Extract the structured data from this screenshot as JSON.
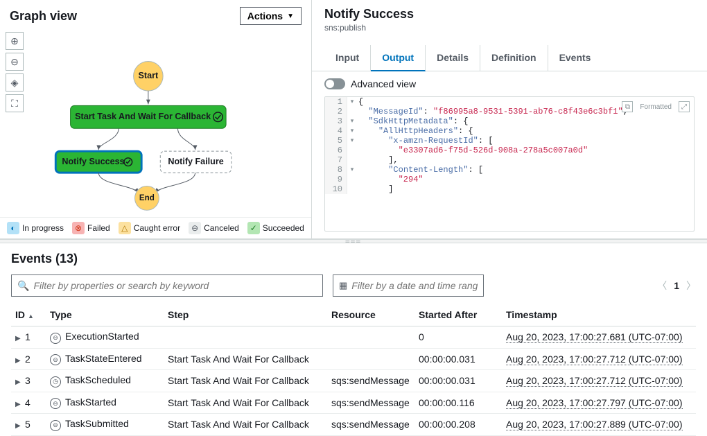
{
  "graph": {
    "title": "Graph view",
    "actions_label": "Actions",
    "nodes": {
      "start": "Start",
      "task": "Start Task And Wait For Callback",
      "success": "Notify Success",
      "failure": "Notify Failure",
      "end": "End"
    },
    "legend": {
      "in_progress": "In progress",
      "failed": "Failed",
      "caught": "Caught error",
      "canceled": "Canceled",
      "succeeded": "Succeeded"
    }
  },
  "detail": {
    "title": "Notify Success",
    "subtitle": "sns:publish",
    "tabs": {
      "input": "Input",
      "output": "Output",
      "details": "Details",
      "definition": "Definition",
      "events": "Events"
    },
    "advanced_label": "Advanced view",
    "formatted_label": "Formatted",
    "code": [
      {
        "n": 1,
        "fold": "▾",
        "indent": 0,
        "tokens": [
          {
            "t": "{",
            "c": "punc"
          }
        ]
      },
      {
        "n": 2,
        "fold": "",
        "indent": 1,
        "tokens": [
          {
            "t": "\"MessageId\"",
            "c": "key"
          },
          {
            "t": ": ",
            "c": "punc"
          },
          {
            "t": "\"f86995a8-9531-5391-ab76-c8f43e6c3bf1\"",
            "c": "str"
          },
          {
            "t": ",",
            "c": "punc"
          }
        ]
      },
      {
        "n": 3,
        "fold": "▾",
        "indent": 1,
        "tokens": [
          {
            "t": "\"SdkHttpMetadata\"",
            "c": "key"
          },
          {
            "t": ": {",
            "c": "punc"
          }
        ]
      },
      {
        "n": 4,
        "fold": "▾",
        "indent": 2,
        "tokens": [
          {
            "t": "\"AllHttpHeaders\"",
            "c": "key"
          },
          {
            "t": ": {",
            "c": "punc"
          }
        ]
      },
      {
        "n": 5,
        "fold": "▾",
        "indent": 3,
        "tokens": [
          {
            "t": "\"x-amzn-RequestId\"",
            "c": "key"
          },
          {
            "t": ": [",
            "c": "punc"
          }
        ]
      },
      {
        "n": 6,
        "fold": "",
        "indent": 4,
        "tokens": [
          {
            "t": "\"e3307ad6-f75d-526d-908a-278a5c007a0d\"",
            "c": "str"
          }
        ]
      },
      {
        "n": 7,
        "fold": "",
        "indent": 3,
        "tokens": [
          {
            "t": "],",
            "c": "punc"
          }
        ]
      },
      {
        "n": 8,
        "fold": "▾",
        "indent": 3,
        "tokens": [
          {
            "t": "\"Content-Length\"",
            "c": "key"
          },
          {
            "t": ": [",
            "c": "punc"
          }
        ]
      },
      {
        "n": 9,
        "fold": "",
        "indent": 4,
        "tokens": [
          {
            "t": "\"294\"",
            "c": "str"
          }
        ]
      },
      {
        "n": 10,
        "fold": "",
        "indent": 3,
        "tokens": [
          {
            "t": "]",
            "c": "punc"
          }
        ]
      }
    ]
  },
  "events": {
    "title": "Events (13)",
    "filter_placeholder": "Filter by properties or search by keyword",
    "date_placeholder": "Filter by a date and time range",
    "page": "1",
    "cols": {
      "id": "ID",
      "type": "Type",
      "step": "Step",
      "resource": "Resource",
      "started": "Started After",
      "timestamp": "Timestamp"
    },
    "rows": [
      {
        "id": "1",
        "type": "ExecutionStarted",
        "icon": "⊖",
        "step": "",
        "resource": "",
        "started": "0",
        "ts": "Aug 20, 2023, 17:00:27.681 (UTC-07:00)"
      },
      {
        "id": "2",
        "type": "TaskStateEntered",
        "icon": "⊖",
        "step": "Start Task And Wait For Callback",
        "resource": "",
        "started": "00:00:00.031",
        "ts": "Aug 20, 2023, 17:00:27.712 (UTC-07:00)"
      },
      {
        "id": "3",
        "type": "TaskScheduled",
        "icon": "◷",
        "step": "Start Task And Wait For Callback",
        "resource": "sqs:sendMessage",
        "started": "00:00:00.031",
        "ts": "Aug 20, 2023, 17:00:27.712 (UTC-07:00)"
      },
      {
        "id": "4",
        "type": "TaskStarted",
        "icon": "⊖",
        "step": "Start Task And Wait For Callback",
        "resource": "sqs:sendMessage",
        "started": "00:00:00.116",
        "ts": "Aug 20, 2023, 17:00:27.797 (UTC-07:00)"
      },
      {
        "id": "5",
        "type": "TaskSubmitted",
        "icon": "⊖",
        "step": "Start Task And Wait For Callback",
        "resource": "sqs:sendMessage",
        "started": "00:00:00.208",
        "ts": "Aug 20, 2023, 17:00:27.889 (UTC-07:00)"
      }
    ]
  }
}
